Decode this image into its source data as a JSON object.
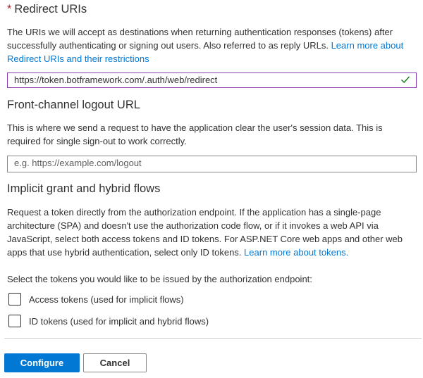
{
  "redirect": {
    "required_mark": "*",
    "title": "Redirect URIs",
    "description": "The URIs we will accept as destinations when returning authentication responses (tokens) after successfully authenticating or signing out users. Also referred to as reply URLs.",
    "link_text": "Learn more about Redirect URIs and their restrictions",
    "uri_value": "https://token.botframework.com/.auth/web/redirect",
    "valid_icon": "checkmark-icon"
  },
  "logout": {
    "title": "Front-channel logout URL",
    "description": "This is where we send a request to have the application clear the user's session data. This is required for single sign-out to work correctly.",
    "placeholder": "e.g. https://example.com/logout",
    "value": ""
  },
  "implicit": {
    "title": "Implicit grant and hybrid flows",
    "description": "Request a token directly from the authorization endpoint. If the application has a single-page architecture (SPA) and doesn't use the authorization code flow, or if it invokes a web API via JavaScript, select both access tokens and ID tokens. For ASP.NET Core web apps and other web apps that use hybrid authentication, select only ID tokens.",
    "link_text": "Learn more about tokens.",
    "select_prompt": "Select the tokens you would like to be issued by the authorization endpoint:",
    "options": [
      {
        "label": "Access tokens (used for implicit flows)",
        "checked": false
      },
      {
        "label": "ID tokens (used for implicit and hybrid flows)",
        "checked": false
      }
    ]
  },
  "actions": {
    "configure_label": "Configure",
    "cancel_label": "Cancel"
  },
  "colors": {
    "accent": "#0078d4",
    "required": "#a4262c",
    "valid_check": "#107c10"
  }
}
